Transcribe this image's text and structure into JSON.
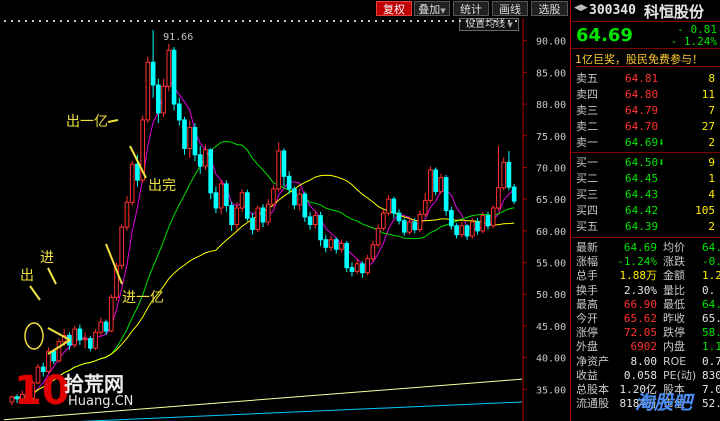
{
  "toolbar": {
    "fuquan": "复权",
    "diejia": "叠加",
    "tongji": "统计",
    "huadang": "画线",
    "xuanjia": "选股",
    "settings": "设置均线"
  },
  "chart_data": {
    "type": "candlestick",
    "title": "",
    "ylim": [
      30,
      92
    ],
    "y_ticks": [
      35.0,
      40.0,
      45.0,
      50.0,
      55.0,
      60.0,
      65.0,
      70.0,
      75.0,
      80.0,
      85.0,
      90.0
    ],
    "peak_label": "91.66",
    "colors": {
      "up": "#ff3030",
      "down": "#00ffff",
      "ma5": "#e000e0",
      "ma10": "#ffff00",
      "ma20": "#00e000",
      "ma60": "#ffffa0",
      "ma120": "#00c8ff"
    },
    "candles": [
      [
        33,
        33.8,
        32.5,
        34
      ],
      [
        33.8,
        33.5,
        32.8,
        34.2
      ],
      [
        33.5,
        34.2,
        33,
        34.8
      ],
      [
        34.2,
        33.6,
        33.2,
        34.6
      ],
      [
        33.6,
        36,
        33.4,
        36.4
      ],
      [
        36,
        38.5,
        35.8,
        39
      ],
      [
        38.5,
        37.8,
        37,
        39.2
      ],
      [
        37.8,
        41,
        37.5,
        41.6
      ],
      [
        41,
        39.5,
        39,
        41.4
      ],
      [
        39.5,
        42.5,
        39.2,
        43
      ],
      [
        42.5,
        43.5,
        41.8,
        44.5
      ],
      [
        43.5,
        42,
        41.2,
        44
      ],
      [
        42,
        44.5,
        41.6,
        45
      ],
      [
        44.5,
        42.8,
        42,
        45.2
      ],
      [
        42.8,
        43,
        41.5,
        44
      ],
      [
        43,
        41.5,
        41,
        43.4
      ],
      [
        41.5,
        44,
        41.2,
        44.5
      ],
      [
        44,
        45.6,
        43.5,
        46.3
      ],
      [
        45.6,
        44.2,
        43.6,
        46
      ],
      [
        44.2,
        49.5,
        44,
        50
      ],
      [
        49.5,
        54.5,
        49,
        55
      ],
      [
        54.5,
        60.6,
        54,
        61
      ],
      [
        60.6,
        64.5,
        60,
        65.5
      ],
      [
        64.5,
        70.5,
        64,
        71
      ],
      [
        70.5,
        68,
        67,
        72
      ],
      [
        68,
        77.5,
        67.6,
        78.2
      ],
      [
        77.5,
        86.6,
        77,
        87.5
      ],
      [
        86.6,
        83,
        81,
        91.66
      ],
      [
        83,
        78.6,
        77,
        84
      ],
      [
        78.6,
        82.8,
        78,
        84
      ],
      [
        82.8,
        88.5,
        82,
        89.5
      ],
      [
        88.5,
        80,
        79,
        89
      ],
      [
        80,
        77.5,
        76.6,
        81
      ],
      [
        77.5,
        73,
        72,
        78
      ],
      [
        73,
        76.3,
        71.5,
        77.4
      ],
      [
        76.3,
        72,
        71,
        77
      ],
      [
        72,
        70.2,
        69,
        73.4
      ],
      [
        70.2,
        72.8,
        69.6,
        73.6
      ],
      [
        72.8,
        66,
        65,
        73
      ],
      [
        66,
        63.6,
        62.8,
        67
      ],
      [
        63.6,
        67.4,
        62.6,
        68
      ],
      [
        67.4,
        64,
        63,
        68
      ],
      [
        64,
        61,
        60,
        64.6
      ],
      [
        61,
        63.6,
        60.2,
        64.5
      ],
      [
        63.6,
        66,
        63,
        66.6
      ],
      [
        66,
        62,
        61.5,
        66.5
      ],
      [
        62,
        60.2,
        59.4,
        62.8
      ],
      [
        60.2,
        63.6,
        59.8,
        64
      ],
      [
        63.6,
        61.4,
        60.6,
        64.2
      ],
      [
        61.4,
        64.2,
        60.8,
        65
      ],
      [
        64.2,
        66.6,
        63.8,
        67.2
      ],
      [
        66.6,
        72.6,
        66.2,
        74
      ],
      [
        72.6,
        68.6,
        67,
        73
      ],
      [
        68.6,
        66.6,
        65.8,
        69.4
      ],
      [
        66.6,
        64.1,
        63.4,
        67
      ],
      [
        64.1,
        65.8,
        63.2,
        66.6
      ],
      [
        65.8,
        62.2,
        61.4,
        66.2
      ],
      [
        62.2,
        61,
        60.2,
        63
      ],
      [
        61,
        62.4,
        60.4,
        63.2
      ],
      [
        62.4,
        58.6,
        57.6,
        63
      ],
      [
        58.6,
        57.4,
        56.6,
        59.4
      ],
      [
        57.4,
        58.6,
        56.8,
        59.2
      ],
      [
        58.6,
        57.1,
        56.4,
        59
      ],
      [
        57.1,
        58,
        56.6,
        58.6
      ],
      [
        58,
        54.2,
        53.5,
        58.4
      ],
      [
        54.2,
        53.6,
        52.8,
        55
      ],
      [
        53.6,
        54.8,
        53.2,
        55.6
      ],
      [
        54.8,
        53.4,
        52.6,
        55.2
      ],
      [
        53.4,
        55.6,
        53,
        56.2
      ],
      [
        55.6,
        57.8,
        55.2,
        58.4
      ],
      [
        57.8,
        60.4,
        57.4,
        61
      ],
      [
        60.4,
        62.8,
        60,
        63.4
      ],
      [
        62.8,
        65,
        62.4,
        65.6
      ],
      [
        65,
        62.8,
        62,
        65.4
      ],
      [
        62.8,
        61.6,
        61,
        63.4
      ],
      [
        61.6,
        59.8,
        59.2,
        62
      ],
      [
        59.8,
        61.4,
        59.4,
        62
      ],
      [
        61.4,
        60.2,
        59.6,
        62
      ],
      [
        60.2,
        62.6,
        59.8,
        63.2
      ],
      [
        62.6,
        64.8,
        62.2,
        66
      ],
      [
        64.8,
        69.6,
        64.4,
        70.2
      ],
      [
        69.6,
        66.2,
        65.6,
        70
      ],
      [
        66.2,
        68.4,
        65.8,
        69
      ],
      [
        68.4,
        63.2,
        62.4,
        68.8
      ],
      [
        63.2,
        60.8,
        60.2,
        63.8
      ],
      [
        60.8,
        59.4,
        58.8,
        61.2
      ],
      [
        59.4,
        60.8,
        59,
        61.4
      ],
      [
        60.8,
        59.2,
        58.6,
        61
      ],
      [
        59.2,
        61.4,
        58.8,
        62
      ],
      [
        61.4,
        60,
        59.4,
        62
      ],
      [
        60,
        62.4,
        59.6,
        63
      ],
      [
        62.4,
        60.8,
        60.2,
        63
      ],
      [
        60.8,
        63.6,
        60.4,
        64
      ],
      [
        63.6,
        66.8,
        63.2,
        73.4
      ],
      [
        66.8,
        70.8,
        66.4,
        71.6
      ],
      [
        70.8,
        66.9,
        66.4,
        72.6
      ],
      [
        66.9,
        64.69,
        64.2,
        67.4
      ]
    ],
    "annotations": [
      "出一亿",
      "出完",
      "进",
      "出",
      "进一亿"
    ]
  },
  "panel": {
    "nav": "◀▶",
    "code": "300340",
    "name": "科恒股份",
    "price": "64.69",
    "change": "- 0.81",
    "change_pct": "- 1.24%",
    "promo": "1亿巨奖，股民免费参与！",
    "asks": [
      {
        "label": "卖五",
        "price": "64.81",
        "vol": "8",
        "cls": "red"
      },
      {
        "label": "卖四",
        "price": "64.80",
        "vol": "11",
        "cls": "red"
      },
      {
        "label": "卖三",
        "price": "64.79",
        "vol": "7",
        "cls": "red"
      },
      {
        "label": "卖二",
        "price": "64.70",
        "vol": "27",
        "cls": "red"
      },
      {
        "label": "卖一",
        "price": "64.69⬇",
        "vol": "2",
        "cls": "green"
      }
    ],
    "bids": [
      {
        "label": "买一",
        "price": "64.50⬇",
        "vol": "9",
        "cls": "green"
      },
      {
        "label": "买二",
        "price": "64.45",
        "vol": "1",
        "cls": "green"
      },
      {
        "label": "买三",
        "price": "64.43",
        "vol": "4",
        "cls": "green"
      },
      {
        "label": "买四",
        "price": "64.42",
        "vol": "105",
        "cls": "green"
      },
      {
        "label": "买五",
        "price": "64.39",
        "vol": "2",
        "cls": "green"
      }
    ],
    "stats": [
      {
        "l1": "最新",
        "v1": "64.69",
        "c1": "green",
        "l2": "均价",
        "v2": "64.",
        "c2": "green"
      },
      {
        "l1": "涨幅",
        "v1": "-1.24%",
        "c1": "green",
        "l2": "涨跌",
        "v2": "-0.",
        "c2": "green"
      },
      {
        "l1": "总手",
        "v1": "1.88万",
        "c1": "yellow",
        "l2": "金额",
        "v2": "1.2",
        "c2": "yellow"
      },
      {
        "l1": "换手",
        "v1": "2.30%",
        "c1": "white",
        "l2": "量比",
        "v2": "0.",
        "c2": "white"
      },
      {
        "l1": "最高",
        "v1": "66.90",
        "c1": "red",
        "l2": "最低",
        "v2": "64.",
        "c2": "green"
      },
      {
        "l1": "今开",
        "v1": "65.62",
        "c1": "red",
        "l2": "昨收",
        "v2": "65.",
        "c2": "white"
      },
      {
        "l1": "涨停",
        "v1": "72.05",
        "c1": "red",
        "l2": "跌停",
        "v2": "58.",
        "c2": "green"
      },
      {
        "l1": "外盘",
        "v1": "6902",
        "c1": "red",
        "l2": "内盘",
        "v2": "1.1",
        "c2": "green"
      },
      {
        "l1": "净资产",
        "v1": "8.00",
        "c1": "white",
        "l2": "ROE",
        "v2": "0.7",
        "c2": "white"
      },
      {
        "l1": "收益",
        "v1": "0.058",
        "c1": "white",
        "l2": "PE(动)",
        "v2": "830",
        "c2": "white"
      },
      {
        "l1": "总股本",
        "v1": "1.20亿",
        "c1": "white",
        "l2": "股本",
        "v2": "7.0",
        "c2": "white"
      },
      {
        "l1": "流通股",
        "v1": "8184万",
        "c1": "white",
        "l2": "市值",
        "v2": "52.9",
        "c2": "white"
      }
    ]
  },
  "watermark": {
    "num": "10",
    "cn": "拾荒网",
    "en": "Huang.CN",
    "right": "淘股吧"
  }
}
